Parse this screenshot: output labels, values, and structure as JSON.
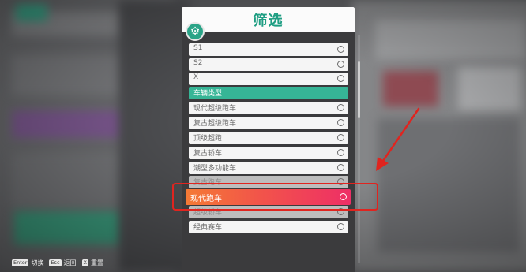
{
  "panel": {
    "title": "筛选",
    "settings_icon": "gear-icon",
    "rows": [
      {
        "label": "S1",
        "kind": "option"
      },
      {
        "label": "S2",
        "kind": "option"
      },
      {
        "label": "X",
        "kind": "option"
      },
      {
        "label": "车辆类型",
        "kind": "header"
      },
      {
        "label": "现代超级跑车",
        "kind": "option"
      },
      {
        "label": "复古超级跑车",
        "kind": "option"
      },
      {
        "label": "顶级超跑",
        "kind": "option"
      },
      {
        "label": "复古轿车",
        "kind": "option"
      },
      {
        "label": "潮型多功能车",
        "kind": "option"
      },
      {
        "label": "复古跑车",
        "kind": "option"
      },
      {
        "label": "现代跑车",
        "kind": "selected"
      },
      {
        "label": "超级轿车",
        "kind": "option"
      },
      {
        "label": "经典赛车",
        "kind": "option"
      }
    ]
  },
  "hints": [
    {
      "key": "Enter",
      "label": "切换"
    },
    {
      "key": "Esc",
      "label": "返回"
    },
    {
      "key": "X",
      "label": "重置"
    }
  ],
  "colors": {
    "accent": "#36b596",
    "selected_start": "#f47a35",
    "selected_end": "#ee2f66",
    "annotation": "#e0241f"
  }
}
